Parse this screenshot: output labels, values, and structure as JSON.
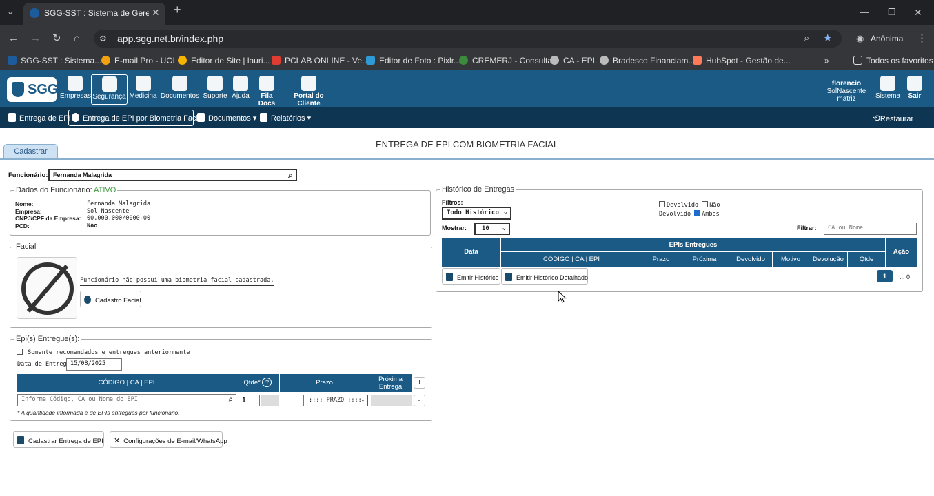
{
  "browser": {
    "tab_title": "SGG-SST : Sistema de Gerencia",
    "url": "app.sgg.net.br/index.php",
    "profile": "Anônima",
    "bookmarks": [
      "SGG-SST : Sistema...",
      "E-mail Pro - UOL",
      "Editor de Site | lauri...",
      "PCLAB ONLINE - Ve...",
      "Editor de Foto : Pixlr...",
      "CREMERJ - Consulta",
      "CA - EPI",
      "Bradesco Financiam...",
      "HubSpot - Gestão de..."
    ],
    "all_bookmarks": "Todos os favoritos"
  },
  "app": {
    "logo": "SGG",
    "nav": [
      "Empresas",
      "Segurança",
      "Medicina",
      "Documentos",
      "Suporte",
      "Ajuda",
      "Fila Docs",
      "Portal do Cliente"
    ],
    "user": {
      "name": "florencio",
      "company": "SolNascente",
      "unit": "matriz"
    },
    "system": "Sistema",
    "exit": "Sair",
    "subnav": [
      "Entrega de EPI",
      "Entrega de EPI por Biometria Facial",
      "Documentos",
      "Relatórios"
    ],
    "restore": "Restaurar"
  },
  "page": {
    "tab": "Cadastrar",
    "title": "ENTREGA DE EPI COM BIOMETRIA FACIAL",
    "funcionario_label": "Funcionário:",
    "funcionario_value": "Fernanda Malagrida"
  },
  "dados": {
    "legend": "Dados do Funcionário:",
    "status": "ATIVO",
    "labels": [
      "Nome:",
      "Empresa:",
      "CNPJ/CPF da Empresa:",
      "PCD:"
    ],
    "values": [
      "Fernanda Malagrida",
      "Sol Nascente",
      "00.000.000/0000-00",
      "Não"
    ]
  },
  "facial": {
    "legend": "Facial",
    "message": "Funcionário não possui uma biometria facial cadastrada.",
    "button": "Cadastro Facial"
  },
  "epis": {
    "legend": "Epi(s) Entregue(s):",
    "only_recommended": "Somente recomendados e entregues anteriormente",
    "date_label": "Data de Entrega:",
    "date_value": "15/08/2025",
    "headers": [
      "CÓDIGO | CA | EPI",
      "Qtde*",
      "Prazo",
      "Próxima Entrega"
    ],
    "search_placeholder": "Informe Código, CA ou Nome do EPI",
    "qty": "1",
    "prazo_select": ":::: PRAZO ::::",
    "note": "* A quantidade informada é de EPIs entregues por funcionário.",
    "add": "+",
    "remove": "-"
  },
  "actions": {
    "save": "Cadastrar Entrega de EPI",
    "config": "Configurações de E-mail/WhatsApp"
  },
  "historico": {
    "legend": "Histórico de Entregas",
    "filtros_label": "Filtros:",
    "filtro_value": "Todo Histórico",
    "devolvido": "Devolvido",
    "nao": "Não",
    "devolvido2": "Devolvido",
    "ambos": "Ambos",
    "mostrar_label": "Mostrar:",
    "mostrar_value": "10",
    "filtrar_label": "Filtrar:",
    "filtrar_placeholder": "CA ou Nome",
    "header_data": "Data",
    "header_group": "EPIs Entregues",
    "header_acao": "Ação",
    "columns": [
      "CÓDIGO | CA | EPI",
      "Prazo",
      "Próxima",
      "Devolvido",
      "Motivo",
      "Devolução",
      "Qtde"
    ],
    "btn_emitir": "Emitir Histórico",
    "btn_emitir_det": "Emitir Histórico Detalhado",
    "page": "1",
    "page_info": "... 0"
  }
}
